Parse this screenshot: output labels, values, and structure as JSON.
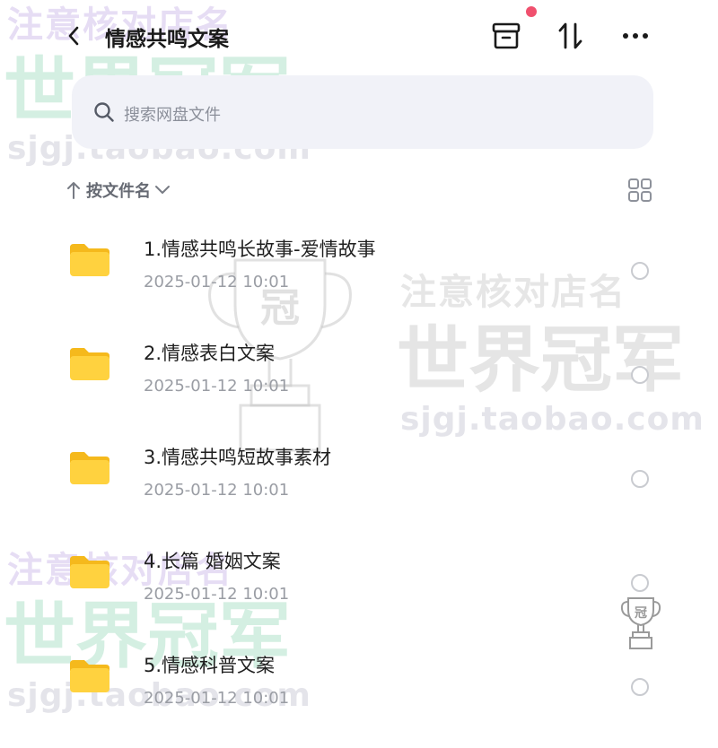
{
  "header": {
    "title": "情感共鸣文案"
  },
  "search": {
    "placeholder": "搜索网盘文件"
  },
  "sort": {
    "label": "按文件名"
  },
  "files": [
    {
      "name": "1.情感共鸣长故事-爱情故事",
      "date": "2025-01-12  10:01"
    },
    {
      "name": "2.情感表白文案",
      "date": "2025-01-12  10:01"
    },
    {
      "name": "3.情感共鸣短故事素材",
      "date": "2025-01-12  10:01"
    },
    {
      "name": "4.长篇 婚姻文案",
      "date": "2025-01-12  10:01"
    },
    {
      "name": "5.情感科普文案",
      "date": "2025-01-12  10:01"
    }
  ],
  "watermark": {
    "line1": "注意核对店名",
    "line2": "世界冠军",
    "line3": "sjgj.taobao.com",
    "badge": "冠"
  },
  "colors": {
    "accent_dot": "#f0506e",
    "folder": "#ffd23f",
    "search_bg": "#f1f2f8"
  }
}
